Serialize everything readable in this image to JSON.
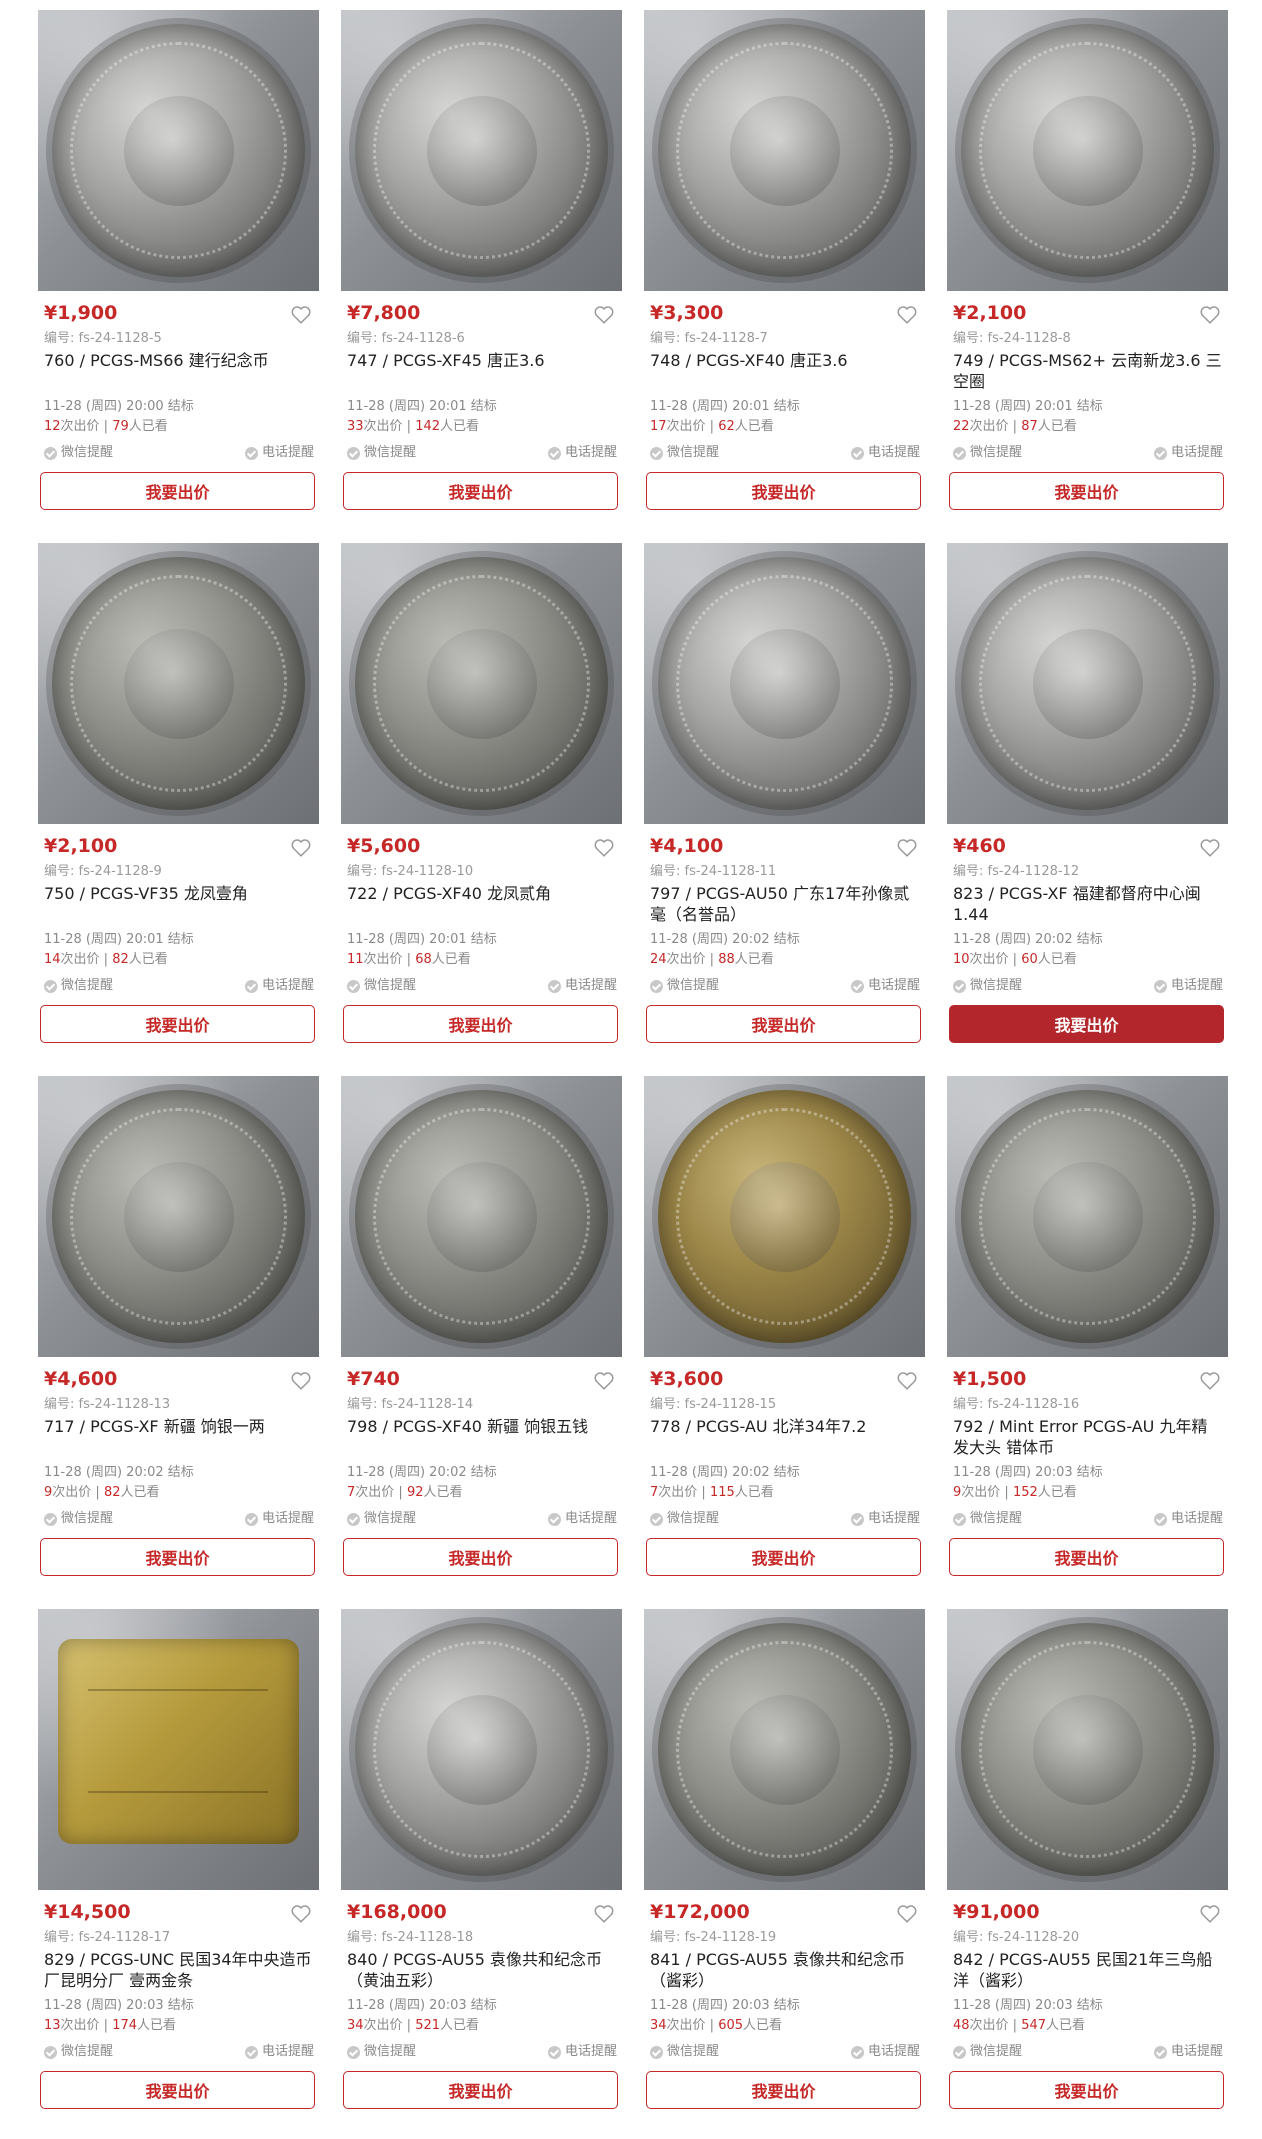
{
  "ui": {
    "bid_label": "我要出价",
    "wechat_reminder": "微信提醒",
    "phone_reminder": "电话提醒",
    "colors": {
      "accent": "#c62828",
      "active_button": "#b3262b"
    }
  },
  "items": [
    {
      "price": "¥1,900",
      "code": "编号: fs-24-1128-5",
      "title": "760 / PCGS-MS66 建行纪念币",
      "time": "11-28 (周四) 20:00 结标",
      "bids": "12",
      "views": "79",
      "active": false,
      "image": "silver-coin"
    },
    {
      "price": "¥7,800",
      "code": "编号: fs-24-1128-6",
      "title": "747 / PCGS-XF45 唐正3.6",
      "time": "11-28 (周四) 20:01 结标",
      "bids": "33",
      "views": "142",
      "active": false,
      "image": "silver-coin"
    },
    {
      "price": "¥3,300",
      "code": "编号: fs-24-1128-7",
      "title": "748 / PCGS-XF40 唐正3.6",
      "time": "11-28 (周四) 20:01 结标",
      "bids": "17",
      "views": "62",
      "active": false,
      "image": "silver-coin"
    },
    {
      "price": "¥2,100",
      "code": "编号: fs-24-1128-8",
      "title": "749 / PCGS-MS62+ 云南新龙3.6 三空圈",
      "time": "11-28 (周四) 20:01 结标",
      "bids": "22",
      "views": "87",
      "active": false,
      "image": "silver-coin"
    },
    {
      "price": "¥2,100",
      "code": "编号: fs-24-1128-9",
      "title": "750 / PCGS-VF35 龙凤壹角",
      "time": "11-28 (周四) 20:01 结标",
      "bids": "14",
      "views": "82",
      "active": false,
      "image": "dark-coin"
    },
    {
      "price": "¥5,600",
      "code": "编号: fs-24-1128-10",
      "title": "722 / PCGS-XF40 龙凤贰角",
      "time": "11-28 (周四) 20:01 结标",
      "bids": "11",
      "views": "68",
      "active": false,
      "image": "dark-coin"
    },
    {
      "price": "¥4,100",
      "code": "编号: fs-24-1128-11",
      "title": "797 / PCGS-AU50 广东17年孙像贰毫（名誉品）",
      "time": "11-28 (周四) 20:02 结标",
      "bids": "24",
      "views": "88",
      "active": false,
      "image": "silver-coin"
    },
    {
      "price": "¥460",
      "code": "编号: fs-24-1128-12",
      "title": "823 / PCGS-XF 福建都督府中心闽1.44",
      "time": "11-28 (周四) 20:02 结标",
      "bids": "10",
      "views": "60",
      "active": true,
      "image": "silver-coin"
    },
    {
      "price": "¥4,600",
      "code": "编号: fs-24-1128-13",
      "title": "717 / PCGS-XF 新疆 饷银一两",
      "time": "11-28 (周四) 20:02 结标",
      "bids": "9",
      "views": "82",
      "active": false,
      "image": "dark-coin"
    },
    {
      "price": "¥740",
      "code": "编号: fs-24-1128-14",
      "title": "798 / PCGS-XF40 新疆 饷银五钱",
      "time": "11-28 (周四) 20:02 结标",
      "bids": "7",
      "views": "92",
      "active": false,
      "image": "dark-coin"
    },
    {
      "price": "¥3,600",
      "code": "编号: fs-24-1128-15",
      "title": "778 / PCGS-AU 北洋34年7.2",
      "time": "11-28 (周四) 20:02 结标",
      "bids": "7",
      "views": "115",
      "active": false,
      "image": "gold-coin"
    },
    {
      "price": "¥1,500",
      "code": "编号: fs-24-1128-16",
      "title": "792 / Mint Error PCGS-AU 九年精发大头 错体币",
      "time": "11-28 (周四) 20:03 结标",
      "bids": "9",
      "views": "152",
      "active": false,
      "image": "dark-coin"
    },
    {
      "price": "¥14,500",
      "code": "编号: fs-24-1128-17",
      "title": "829 / PCGS-UNC 民国34年中央造币厂昆明分厂 壹两金条",
      "time": "11-28 (周四) 20:03 结标",
      "bids": "13",
      "views": "174",
      "active": false,
      "image": "gold-ingot"
    },
    {
      "price": "¥168,000",
      "code": "编号: fs-24-1128-18",
      "title": "840 / PCGS-AU55 袁像共和纪念币（黄油五彩）",
      "time": "11-28 (周四) 20:03 结标",
      "bids": "34",
      "views": "521",
      "active": false,
      "image": "silver-coin"
    },
    {
      "price": "¥172,000",
      "code": "编号: fs-24-1128-19",
      "title": "841 / PCGS-AU55 袁像共和纪念币（酱彩）",
      "time": "11-28 (周四) 20:03 结标",
      "bids": "34",
      "views": "605",
      "active": false,
      "image": "dark-coin"
    },
    {
      "price": "¥91,000",
      "code": "编号: fs-24-1128-20",
      "title": "842 / PCGS-AU55 民国21年三鸟船洋（酱彩）",
      "time": "11-28 (周四) 20:03 结标",
      "bids": "48",
      "views": "547",
      "active": false,
      "image": "dark-coin"
    }
  ]
}
